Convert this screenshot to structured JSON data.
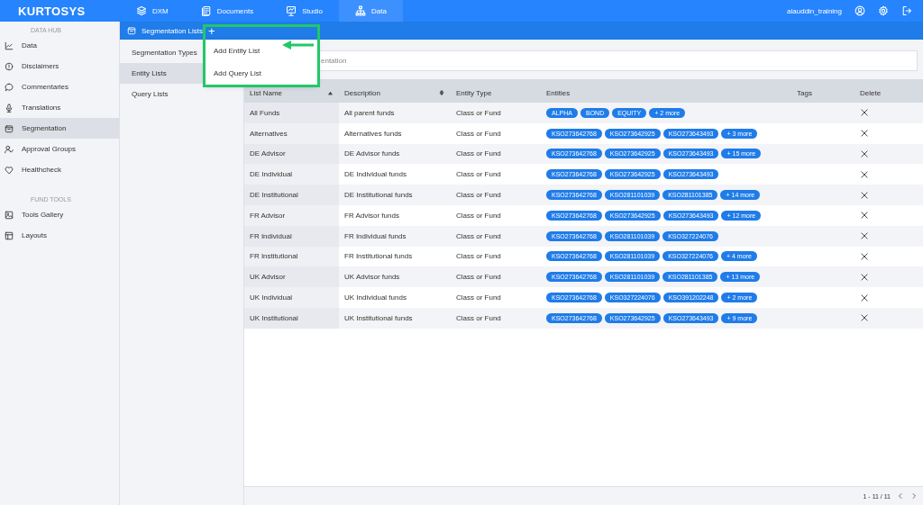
{
  "header": {
    "logo": "KURTOSYS",
    "nav": [
      {
        "label": "DXM",
        "selected": false
      },
      {
        "label": "Documents",
        "selected": false
      },
      {
        "label": "Studio",
        "selected": false
      },
      {
        "label": "Data",
        "selected": true
      }
    ],
    "user": "alauddin_training"
  },
  "sidebar": {
    "sections": [
      {
        "title": "DATA HUB",
        "items": [
          {
            "label": "Data",
            "selected": false
          },
          {
            "label": "Disclaimers",
            "selected": false
          },
          {
            "label": "Commentaries",
            "selected": false
          },
          {
            "label": "Translations",
            "selected": false
          },
          {
            "label": "Segmentation",
            "selected": true
          },
          {
            "label": "Approval Groups",
            "selected": false
          },
          {
            "label": "Healthcheck",
            "selected": false
          }
        ]
      },
      {
        "title": "FUND TOOLS",
        "items": [
          {
            "label": "Tools Gallery",
            "selected": false
          },
          {
            "label": "Layouts",
            "selected": false
          }
        ]
      }
    ]
  },
  "subheader": {
    "title": "Segmentation Lists",
    "add": "+"
  },
  "subnav": [
    {
      "label": "Segmentation Types",
      "selected": false
    },
    {
      "label": "Entity Lists",
      "selected": true
    },
    {
      "label": "Query Lists",
      "selected": false
    }
  ],
  "menu": {
    "items": [
      "Add Entity List",
      "Add Query List"
    ],
    "highlighted": true
  },
  "search": {
    "placeholder": "entation"
  },
  "table": {
    "columns": [
      "List Name",
      "Description",
      "Entity Type",
      "Entities",
      "Tags",
      "Delete"
    ],
    "rows": [
      {
        "name": "All Funds",
        "description": "All parent funds",
        "type": "Class or Fund",
        "entities": [
          "ALPHA",
          "BOND",
          "EQUITY",
          "+ 2 more"
        ]
      },
      {
        "name": "Alternatives",
        "description": "Alternatives funds",
        "type": "Class or Fund",
        "entities": [
          "KSO273642768",
          "KSO273642925",
          "KSO273643493",
          "+ 3 more"
        ]
      },
      {
        "name": "DE Advisor",
        "description": "DE Advisor funds",
        "type": "Class or Fund",
        "entities": [
          "KSO273642768",
          "KSO273642925",
          "KSO273643493",
          "+ 15 more"
        ]
      },
      {
        "name": "DE Individual",
        "description": "DE Individual funds",
        "type": "Class or Fund",
        "entities": [
          "KSO273642768",
          "KSO273642925",
          "KSO273643493"
        ]
      },
      {
        "name": "DE Institutional",
        "description": "DE Institutional funds",
        "type": "Class or Fund",
        "entities": [
          "KSO273642768",
          "KSO281101039",
          "KSO281101385",
          "+ 14 more"
        ]
      },
      {
        "name": "FR Advisor",
        "description": "FR Advisor funds",
        "type": "Class or Fund",
        "entities": [
          "KSO273642768",
          "KSO273642925",
          "KSO273643493",
          "+ 12 more"
        ]
      },
      {
        "name": "FR Individual",
        "description": "FR Individual funds",
        "type": "Class or Fund",
        "entities": [
          "KSO273642768",
          "KSO281101039",
          "KSO327224076"
        ]
      },
      {
        "name": "FR Institutional",
        "description": "FR Institutional funds",
        "type": "Class or Fund",
        "entities": [
          "KSO273642768",
          "KSO281101039",
          "KSO327224076",
          "+ 4 more"
        ]
      },
      {
        "name": "UK Advisor",
        "description": "UK Advisor funds",
        "type": "Class or Fund",
        "entities": [
          "KSO273642768",
          "KSO281101039",
          "KSO281101385",
          "+ 13 more"
        ]
      },
      {
        "name": "UK Individual",
        "description": "UK Individual funds",
        "type": "Class or Fund",
        "entities": [
          "KSO273642768",
          "KSO327224076",
          "KSO391202248",
          "+ 2 more"
        ]
      },
      {
        "name": "UK Institutional",
        "description": "UK Institutional funds",
        "type": "Class or Fund",
        "entities": [
          "KSO273642768",
          "KSO273642925",
          "KSO273643493",
          "+ 9 more"
        ]
      }
    ]
  },
  "pagination": "1 - 11 / 11"
}
